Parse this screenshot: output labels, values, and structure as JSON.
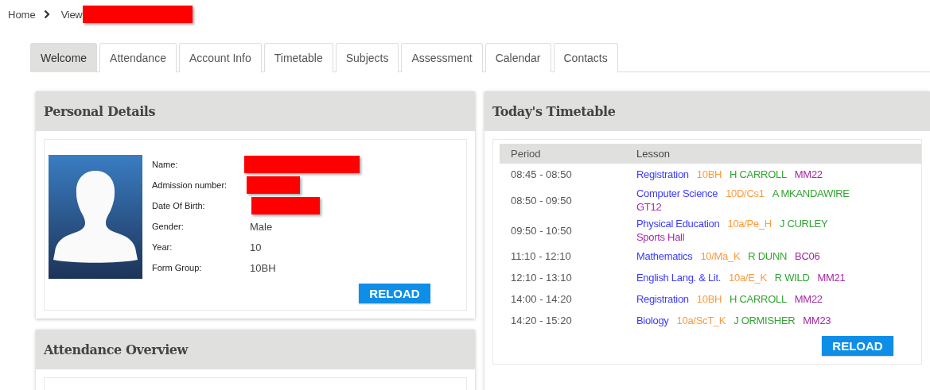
{
  "breadcrumb": {
    "home": "Home",
    "current": "View",
    "current_redacted": true
  },
  "tabs": [
    {
      "label": "Welcome",
      "selected": true
    },
    {
      "label": "Attendance",
      "selected": false
    },
    {
      "label": "Account Info",
      "selected": false
    },
    {
      "label": "Timetable",
      "selected": false
    },
    {
      "label": "Subjects",
      "selected": false
    },
    {
      "label": "Assessment",
      "selected": false
    },
    {
      "label": "Calendar",
      "selected": false
    },
    {
      "label": "Contacts",
      "selected": false
    }
  ],
  "personal_details": {
    "title": "Personal Details",
    "fields": [
      {
        "label": "Name:",
        "redacted": true
      },
      {
        "label": "Admission number:",
        "redacted": true
      },
      {
        "label": "Date Of Birth:",
        "redacted": true
      },
      {
        "label": "Gender:",
        "value": "Male",
        "redacted": false
      },
      {
        "label": "Year:",
        "value": "10",
        "redacted": false
      },
      {
        "label": "Form Group:",
        "value": "10BH",
        "redacted": false
      }
    ],
    "button": "RELOAD"
  },
  "attendance_overview": {
    "title": "Attendance Overview"
  },
  "timetable": {
    "title": "Today's Timetable",
    "columns": [
      "Period",
      "Lesson"
    ],
    "rows": [
      {
        "period": "08:45 - 08:50",
        "parts": [
          {
            "text": "Registration",
            "color": "#3b3bff"
          },
          {
            "text": "10BH",
            "color": "#ff9a3c"
          },
          {
            "text": "H CARROLL",
            "color": "#33a333"
          },
          {
            "text": "MM22",
            "color": "#a52aa5"
          }
        ]
      },
      {
        "period": "08:50 - 09:50",
        "parts": [
          {
            "text": "Computer Science",
            "color": "#3b3bff"
          },
          {
            "text": "10D/Cs1",
            "color": "#ff9a3c"
          },
          {
            "text": "A MKANDAWIRE",
            "color": "#33a333"
          },
          {
            "text": "GT12",
            "color": "#a52aa5"
          }
        ]
      },
      {
        "period": "09:50 - 10:50",
        "parts": [
          {
            "text": "Physical Education",
            "color": "#3b3bff"
          },
          {
            "text": "10a/Pe_H",
            "color": "#ff9a3c"
          },
          {
            "text": "J CURLEY",
            "color": "#33a333"
          },
          {
            "text": "Sports Hall",
            "color": "#a52aa5"
          }
        ]
      },
      {
        "period": "11:10 - 12:10",
        "parts": [
          {
            "text": "Mathematics",
            "color": "#3b3bff"
          },
          {
            "text": "10/Ma_K",
            "color": "#ff9a3c"
          },
          {
            "text": "R DUNN",
            "color": "#33a333"
          },
          {
            "text": "BC06",
            "color": "#a52aa5"
          }
        ]
      },
      {
        "period": "12:10 - 13:10",
        "parts": [
          {
            "text": "English Lang. & Lit.",
            "color": "#3b3bff"
          },
          {
            "text": "10a/E_K",
            "color": "#ff9a3c"
          },
          {
            "text": "R WILD",
            "color": "#33a333"
          },
          {
            "text": "MM21",
            "color": "#a52aa5"
          }
        ]
      },
      {
        "period": "14:00 - 14:20",
        "parts": [
          {
            "text": "Registration",
            "color": "#3b3bff"
          },
          {
            "text": "10BH",
            "color": "#ff9a3c"
          },
          {
            "text": "H CARROLL",
            "color": "#33a333"
          },
          {
            "text": "MM22",
            "color": "#a52aa5"
          }
        ]
      },
      {
        "period": "14:20 - 15:20",
        "parts": [
          {
            "text": "Biology",
            "color": "#3b3bff"
          },
          {
            "text": "10a/ScT_K",
            "color": "#ff9a3c"
          },
          {
            "text": "J ORMISHER",
            "color": "#33a333"
          },
          {
            "text": "MM23",
            "color": "#a52aa5"
          }
        ]
      }
    ],
    "button": "RELOAD"
  }
}
